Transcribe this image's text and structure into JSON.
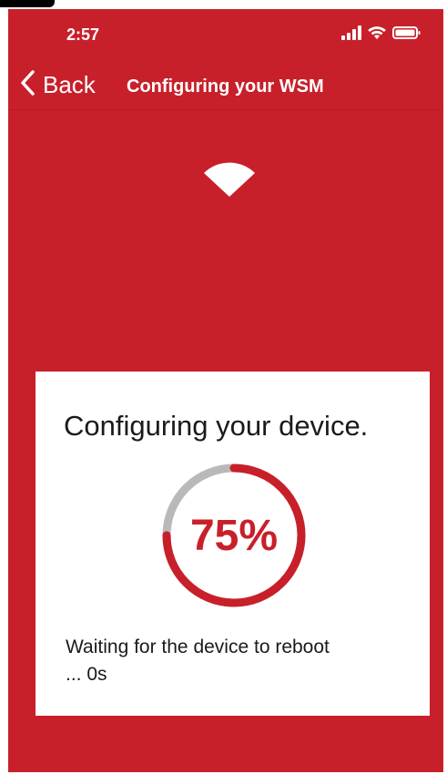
{
  "status_bar": {
    "time": "2:57",
    "icons": [
      "signal-icon",
      "wifi-icon",
      "battery-icon"
    ]
  },
  "nav": {
    "back_label": "Back",
    "title": "Configuring your WSM",
    "back_icon": "chevron-left-icon"
  },
  "hero": {
    "icon": "wifi-icon"
  },
  "card": {
    "title": "Configuring your device.",
    "progress_percent": 75,
    "progress_label": "75%",
    "status_message": "Waiting for the device to reboot ... 0s"
  },
  "colors": {
    "brand_red": "#c8202a",
    "ring_track": "#b9b9b9",
    "card_bg": "#ffffff",
    "text_dark": "#1a1a1a"
  }
}
